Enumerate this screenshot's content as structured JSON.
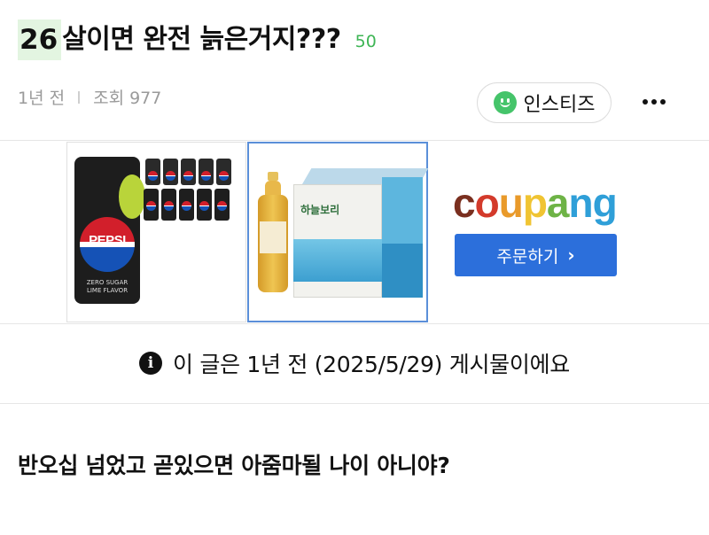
{
  "post": {
    "title_highlight": "26",
    "title_rest": "살이면 완전 늙은거지???",
    "comment_count": "50",
    "age": "1년 전",
    "views": "조회 977",
    "board_name": "인스티즈",
    "notice": "이 글은 1년 전 (2025/5/29) 게시물이에요",
    "body": "반오십 넘었고 곧있으면 아줌마될 나이 아니야?"
  },
  "ad": {
    "pepsi_logo_text": "PEPSI",
    "pepsi_can_subtext": "ZERO SUGAR LIME FLAVOR",
    "tea_brand": "하늘보리",
    "coupang_letters": [
      "c",
      "o",
      "u",
      "p",
      "a",
      "n",
      "g"
    ],
    "coupang_colors": [
      "#7a2f1f",
      "#d33a2b",
      "#e99a2a",
      "#f0c432",
      "#6eb346",
      "#2f9fd8",
      "#2f9fd8"
    ],
    "order_button_label": "주문하기",
    "order_button_chevron": "›"
  },
  "colors": {
    "comment_count": "#3eb555",
    "title_highlight_bg": "#e3f5e1",
    "order_button_bg": "#2c6fdb"
  },
  "icons": {
    "board_icon": "smile-icon",
    "more_icon": "more-horizontal-icon",
    "notice_icon": "info-icon"
  }
}
